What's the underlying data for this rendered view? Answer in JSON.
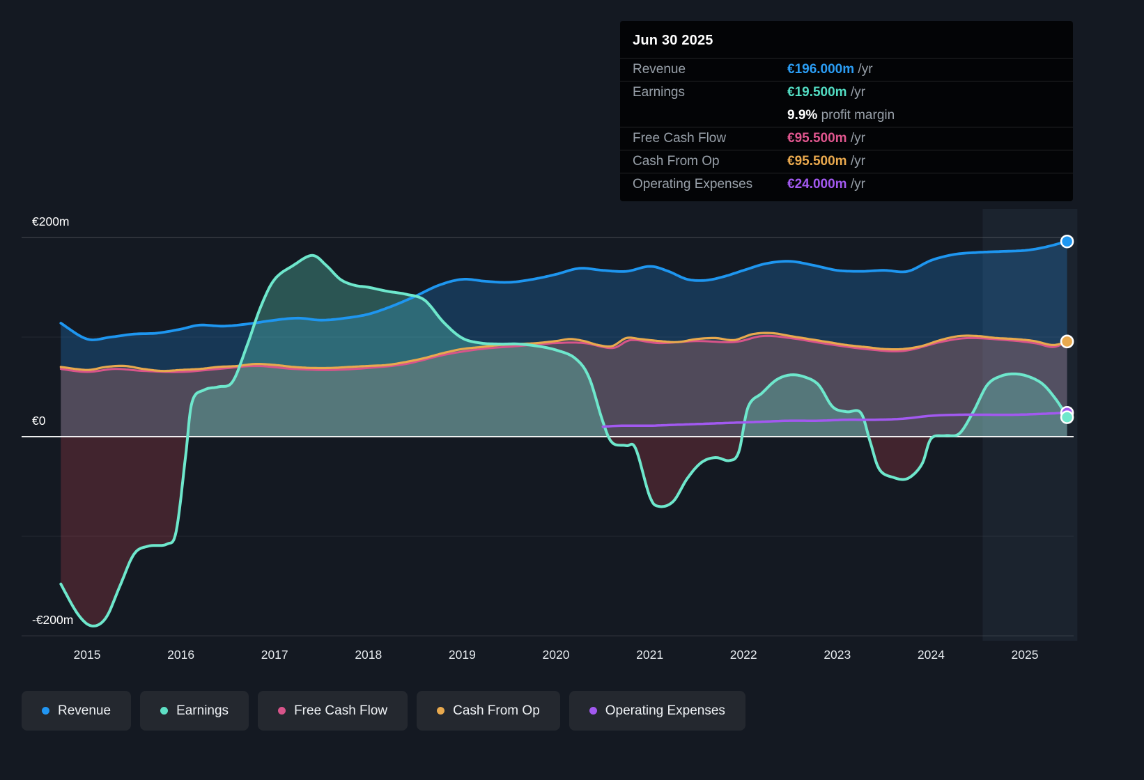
{
  "tooltip": {
    "date": "Jun 30 2025",
    "rows": [
      {
        "label": "Revenue",
        "value": "€196.000m",
        "suffix": " /yr",
        "color": "#2b9df4"
      },
      {
        "label": "Earnings",
        "value": "€19.500m",
        "suffix": " /yr",
        "color": "#52dcc2"
      },
      {
        "label": "",
        "value": "9.9%",
        "suffix": " profit margin",
        "color": "#ffffff"
      },
      {
        "label": "Free Cash Flow",
        "value": "€95.500m",
        "suffix": " /yr",
        "color": "#e0568e"
      },
      {
        "label": "Cash From Op",
        "value": "€95.500m",
        "suffix": " /yr",
        "color": "#eaa94e"
      },
      {
        "label": "Operating Expenses",
        "value": "€24.000m",
        "suffix": " /yr",
        "color": "#a259f0"
      }
    ]
  },
  "legend": [
    {
      "label": "Revenue",
      "color": "#2196f3"
    },
    {
      "label": "Earnings",
      "color": "#5ee0c5"
    },
    {
      "label": "Free Cash Flow",
      "color": "#d8548a"
    },
    {
      "label": "Cash From Op",
      "color": "#e8a94e"
    },
    {
      "label": "Operating Expenses",
      "color": "#a259f0"
    }
  ],
  "chart_data": {
    "type": "area",
    "title": "",
    "y_unit": "€m",
    "x_ticks": [
      2015,
      2016,
      2017,
      2018,
      2019,
      2020,
      2021,
      2022,
      2023,
      2024,
      2025
    ],
    "y_ticks": [
      {
        "label": "€200m",
        "value": 200
      },
      {
        "label": "€0",
        "value": 0
      },
      {
        "label": "-€200m",
        "value": -200
      }
    ],
    "y_gridlines": [
      200,
      100,
      0,
      -100,
      -200
    ],
    "x_range": [
      2014.55,
      2025.55
    ],
    "y_range": [
      -200,
      200
    ],
    "highlight_band": {
      "from": 2024.55,
      "to": 2025.56
    },
    "series": [
      {
        "name": "Revenue",
        "color": "#1e96f0",
        "fill": "rgba(32,125,205,0.30)",
        "points": [
          [
            2014.72,
            114
          ],
          [
            2015.0,
            98
          ],
          [
            2015.25,
            100
          ],
          [
            2015.5,
            103
          ],
          [
            2015.75,
            104
          ],
          [
            2016.0,
            108
          ],
          [
            2016.2,
            112
          ],
          [
            2016.45,
            111
          ],
          [
            2016.7,
            113
          ],
          [
            2017.0,
            117
          ],
          [
            2017.25,
            119
          ],
          [
            2017.5,
            117
          ],
          [
            2017.75,
            119
          ],
          [
            2018.0,
            123
          ],
          [
            2018.25,
            131
          ],
          [
            2018.5,
            141
          ],
          [
            2018.75,
            152
          ],
          [
            2019.0,
            158
          ],
          [
            2019.25,
            156
          ],
          [
            2019.5,
            155
          ],
          [
            2019.75,
            158
          ],
          [
            2020.0,
            163
          ],
          [
            2020.25,
            169
          ],
          [
            2020.5,
            167
          ],
          [
            2020.75,
            166
          ],
          [
            2021.0,
            171
          ],
          [
            2021.2,
            166
          ],
          [
            2021.4,
            158
          ],
          [
            2021.6,
            157
          ],
          [
            2021.8,
            161
          ],
          [
            2022.0,
            167
          ],
          [
            2022.25,
            174
          ],
          [
            2022.5,
            176
          ],
          [
            2022.75,
            172
          ],
          [
            2023.0,
            167
          ],
          [
            2023.25,
            166
          ],
          [
            2023.5,
            167
          ],
          [
            2023.75,
            166
          ],
          [
            2024.0,
            177
          ],
          [
            2024.25,
            183
          ],
          [
            2024.5,
            185
          ],
          [
            2024.75,
            186
          ],
          [
            2025.0,
            187
          ],
          [
            2025.2,
            190
          ],
          [
            2025.45,
            196
          ]
        ]
      },
      {
        "name": "Free Cash Flow",
        "color": "#d8548a",
        "fill": "rgba(216,84,138,0.17)",
        "points": [
          [
            2014.72,
            68
          ],
          [
            2015.0,
            65
          ],
          [
            2015.3,
            68
          ],
          [
            2015.6,
            66
          ],
          [
            2016.0,
            65
          ],
          [
            2016.4,
            68
          ],
          [
            2016.8,
            71
          ],
          [
            2017.2,
            68
          ],
          [
            2017.6,
            67
          ],
          [
            2018.0,
            69
          ],
          [
            2018.4,
            73
          ],
          [
            2018.8,
            82
          ],
          [
            2019.2,
            88
          ],
          [
            2019.6,
            91
          ],
          [
            2020.0,
            94
          ],
          [
            2020.3,
            94
          ],
          [
            2020.6,
            89
          ],
          [
            2020.8,
            97
          ],
          [
            2021.1,
            94
          ],
          [
            2021.5,
            96
          ],
          [
            2021.9,
            95
          ],
          [
            2022.2,
            101
          ],
          [
            2022.5,
            99
          ],
          [
            2022.9,
            93
          ],
          [
            2023.3,
            88
          ],
          [
            2023.7,
            86
          ],
          [
            2024.1,
            95
          ],
          [
            2024.4,
            99
          ],
          [
            2024.8,
            97
          ],
          [
            2025.1,
            94
          ],
          [
            2025.3,
            90
          ],
          [
            2025.45,
            95.5
          ]
        ]
      },
      {
        "name": "Cash From Op",
        "color": "#e8a94e",
        "fill": "rgba(232,169,78,0.14)",
        "points": [
          [
            2014.72,
            70
          ],
          [
            2015.0,
            67
          ],
          [
            2015.2,
            70
          ],
          [
            2015.4,
            71
          ],
          [
            2015.6,
            68
          ],
          [
            2015.8,
            66
          ],
          [
            2016.0,
            67
          ],
          [
            2016.2,
            68
          ],
          [
            2016.4,
            70
          ],
          [
            2016.6,
            71
          ],
          [
            2016.8,
            73
          ],
          [
            2017.0,
            72
          ],
          [
            2017.2,
            70
          ],
          [
            2017.4,
            69
          ],
          [
            2017.6,
            69
          ],
          [
            2017.8,
            70
          ],
          [
            2018.0,
            71
          ],
          [
            2018.2,
            72
          ],
          [
            2018.4,
            75
          ],
          [
            2018.6,
            79
          ],
          [
            2018.8,
            84
          ],
          [
            2019.0,
            88
          ],
          [
            2019.2,
            90
          ],
          [
            2019.4,
            92
          ],
          [
            2019.6,
            93
          ],
          [
            2019.8,
            94
          ],
          [
            2020.0,
            96
          ],
          [
            2020.15,
            98
          ],
          [
            2020.3,
            96
          ],
          [
            2020.45,
            92
          ],
          [
            2020.6,
            91
          ],
          [
            2020.75,
            99
          ],
          [
            2020.9,
            98
          ],
          [
            2021.1,
            96
          ],
          [
            2021.3,
            95
          ],
          [
            2021.5,
            98
          ],
          [
            2021.7,
            99
          ],
          [
            2021.9,
            97
          ],
          [
            2022.1,
            103
          ],
          [
            2022.3,
            104
          ],
          [
            2022.5,
            101
          ],
          [
            2022.7,
            98
          ],
          [
            2022.9,
            95
          ],
          [
            2023.1,
            92
          ],
          [
            2023.3,
            90
          ],
          [
            2023.5,
            88
          ],
          [
            2023.7,
            88
          ],
          [
            2023.9,
            91
          ],
          [
            2024.1,
            97
          ],
          [
            2024.3,
            101
          ],
          [
            2024.5,
            101
          ],
          [
            2024.7,
            99
          ],
          [
            2024.9,
            98
          ],
          [
            2025.1,
            96
          ],
          [
            2025.3,
            92
          ],
          [
            2025.45,
            95.5
          ]
        ]
      },
      {
        "name": "Earnings",
        "color": "#6ee7cc",
        "fill_positive": "rgba(100,225,198,0.30)",
        "fill_negative": "rgba(198,68,80,0.26)",
        "points": [
          [
            2014.72,
            -148
          ],
          [
            2014.9,
            -178
          ],
          [
            2015.05,
            -190
          ],
          [
            2015.2,
            -182
          ],
          [
            2015.35,
            -150
          ],
          [
            2015.5,
            -118
          ],
          [
            2015.65,
            -110
          ],
          [
            2015.85,
            -108
          ],
          [
            2015.95,
            -95
          ],
          [
            2016.05,
            -20
          ],
          [
            2016.12,
            35
          ],
          [
            2016.25,
            47
          ],
          [
            2016.4,
            50
          ],
          [
            2016.55,
            55
          ],
          [
            2016.7,
            90
          ],
          [
            2016.85,
            130
          ],
          [
            2017.0,
            158
          ],
          [
            2017.2,
            172
          ],
          [
            2017.4,
            182
          ],
          [
            2017.55,
            172
          ],
          [
            2017.7,
            158
          ],
          [
            2017.85,
            152
          ],
          [
            2018.0,
            150
          ],
          [
            2018.2,
            146
          ],
          [
            2018.4,
            143
          ],
          [
            2018.6,
            137
          ],
          [
            2018.8,
            115
          ],
          [
            2019.0,
            99
          ],
          [
            2019.2,
            94
          ],
          [
            2019.4,
            93
          ],
          [
            2019.6,
            93
          ],
          [
            2019.8,
            91
          ],
          [
            2020.0,
            87
          ],
          [
            2020.2,
            79
          ],
          [
            2020.35,
            60
          ],
          [
            2020.5,
            15
          ],
          [
            2020.6,
            -6
          ],
          [
            2020.75,
            -9
          ],
          [
            2020.85,
            -12
          ],
          [
            2021.0,
            -60
          ],
          [
            2021.1,
            -70
          ],
          [
            2021.25,
            -65
          ],
          [
            2021.4,
            -42
          ],
          [
            2021.55,
            -26
          ],
          [
            2021.7,
            -21
          ],
          [
            2021.85,
            -24
          ],
          [
            2021.95,
            -15
          ],
          [
            2022.05,
            30
          ],
          [
            2022.2,
            44
          ],
          [
            2022.35,
            57
          ],
          [
            2022.5,
            62
          ],
          [
            2022.65,
            60
          ],
          [
            2022.8,
            52
          ],
          [
            2022.95,
            30
          ],
          [
            2023.1,
            25
          ],
          [
            2023.25,
            24
          ],
          [
            2023.35,
            -5
          ],
          [
            2023.45,
            -33
          ],
          [
            2023.6,
            -41
          ],
          [
            2023.75,
            -42
          ],
          [
            2023.9,
            -28
          ],
          [
            2024.0,
            -2
          ],
          [
            2024.15,
            1
          ],
          [
            2024.3,
            3
          ],
          [
            2024.45,
            25
          ],
          [
            2024.6,
            52
          ],
          [
            2024.75,
            61
          ],
          [
            2024.9,
            63
          ],
          [
            2025.05,
            60
          ],
          [
            2025.2,
            52
          ],
          [
            2025.35,
            35
          ],
          [
            2025.45,
            19.5
          ]
        ]
      },
      {
        "name": "Operating Expenses",
        "color": "#a259f0",
        "points": [
          [
            2020.5,
            10
          ],
          [
            2020.7,
            11
          ],
          [
            2021.0,
            11
          ],
          [
            2021.3,
            12
          ],
          [
            2021.6,
            13
          ],
          [
            2021.9,
            14
          ],
          [
            2022.2,
            15
          ],
          [
            2022.5,
            16
          ],
          [
            2022.8,
            16
          ],
          [
            2023.1,
            17
          ],
          [
            2023.4,
            17
          ],
          [
            2023.7,
            18
          ],
          [
            2024.0,
            21
          ],
          [
            2024.3,
            22
          ],
          [
            2024.6,
            22
          ],
          [
            2024.9,
            22
          ],
          [
            2025.2,
            23
          ],
          [
            2025.45,
            24
          ]
        ]
      }
    ]
  }
}
